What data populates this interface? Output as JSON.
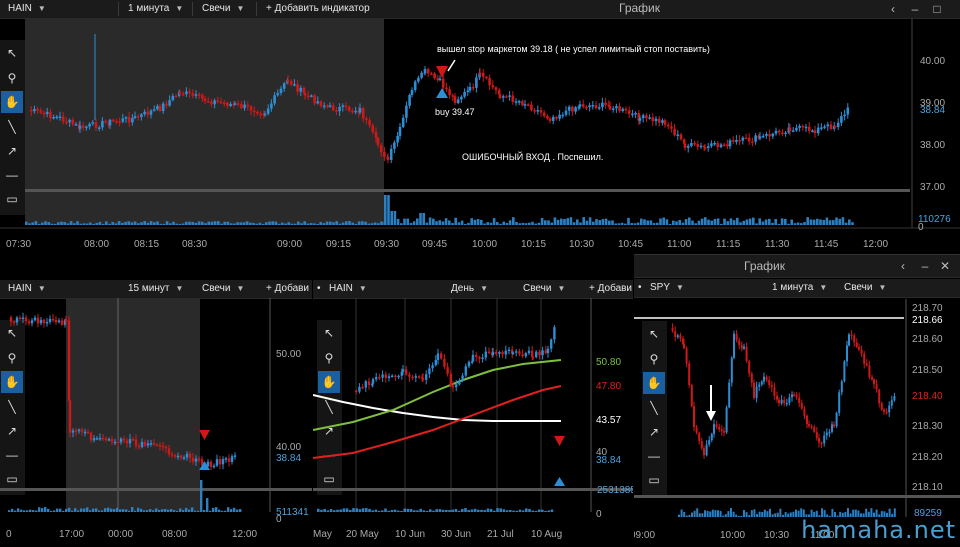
{
  "top": {
    "symbol": "HAIN",
    "interval": "1 минута",
    "chart_style": "Свечи",
    "add_indicator": "+ Добавить индикатор",
    "title": "График",
    "price_ticks": [
      "40.00",
      "39.00",
      "38.00",
      "37.00"
    ],
    "current_price": "38.84",
    "volume_label": "110276",
    "volume_zero": "0",
    "time_ticks": [
      "07:30",
      "08:00",
      "08:15",
      "08:30",
      "09:00",
      "09:15",
      "09:30",
      "09:45",
      "10:00",
      "10:15",
      "10:30",
      "10:45",
      "11:00",
      "11:15",
      "11:30",
      "11:45",
      "12:00"
    ],
    "note_exit": "вышел stop  маркетом 39.18 ( не успел лимитный стоп поставить)",
    "note_buy": "buy 39.47",
    "note_error": "ОШИБОЧНЫЙ ВХОД . Поспешил."
  },
  "left": {
    "symbol": "HAIN",
    "interval": "15 минут",
    "chart_style": "Свечи",
    "add": "+ Добави",
    "price_ticks": [
      "50.00",
      "40.00"
    ],
    "current_price": "38.84",
    "volume_label": "511341",
    "volume_zero": "0",
    "time_ticks": [
      "0",
      "17:00",
      "00:00",
      "08:00",
      "12:00"
    ]
  },
  "mid": {
    "symbol": "HAIN",
    "interval": "День",
    "chart_style": "Свечи",
    "add": "+ Добави",
    "ma_labels": [
      {
        "value": "50.80",
        "color": "#7fbf3f"
      },
      {
        "value": "47.80",
        "color": "#e02020"
      },
      {
        "value": "43.57",
        "color": "#ffffff"
      },
      {
        "value": "40",
        "color": "#aaaaaa"
      },
      {
        "value": "38.84",
        "color": "#4aa3df"
      }
    ],
    "volume_label": "2531385",
    "volume_zero": "0",
    "time_ticks": [
      "May",
      "20 May",
      "10 Jun",
      "30 Jun",
      "21 Jul",
      "10 Aug"
    ]
  },
  "right": {
    "title": "График",
    "symbol": "SPY",
    "interval": "1 минута",
    "chart_style": "Свечи",
    "price_ticks": [
      "218.70",
      "218.66",
      "218.60",
      "218.50",
      "218.40",
      "218.30",
      "218.20",
      "218.10"
    ],
    "current_price": "218.40",
    "volume_label": "89259",
    "time_ticks": [
      "09:00",
      "10:00",
      "10:30",
      "11:00"
    ]
  },
  "watermark": "hamaha.net",
  "colors": {
    "up": "#2c8fd6",
    "down": "#d01818",
    "accent": "#1a5fa0",
    "sma_green": "#7fbf3f",
    "sma_red": "#e02020"
  },
  "icons": [
    "arrow-cursor-icon",
    "magnifier-icon",
    "hand-icon",
    "line-icon",
    "arrow-line-icon",
    "horizontal-line-icon",
    "rectangle-icon"
  ]
}
